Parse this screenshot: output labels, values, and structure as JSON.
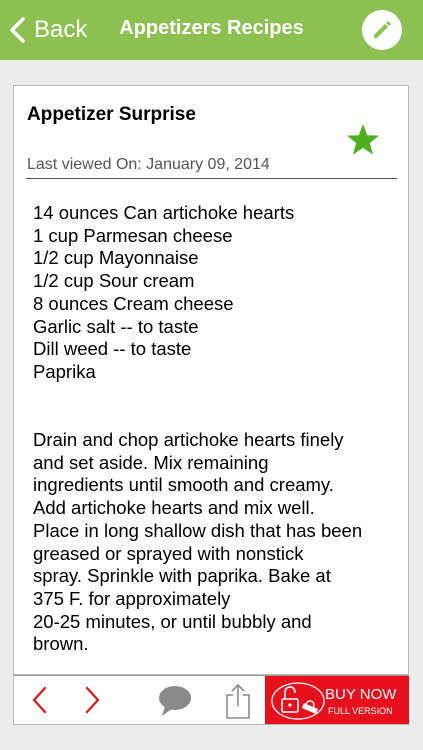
{
  "nav": {
    "back_label": "Back",
    "title": "Appetizers Recipes"
  },
  "recipe": {
    "title": "Appetizer Surprise",
    "last_viewed": "Last viewed On: January 09, 2014",
    "favorite": true,
    "ingredients": [
      "14 ounces Can artichoke hearts",
      "1 cup Parmesan cheese",
      "1/2 cup Mayonnaise",
      "1/2 cup Sour cream",
      "8 ounces Cream cheese",
      "Garlic salt -- to taste",
      "Dill weed -- to taste",
      "Paprika"
    ],
    "directions": [
      "Drain and chop artichoke hearts finely",
      "and set aside. Mix remaining",
      "ingredients until smooth and creamy.",
      "Add artichoke hearts and mix well.",
      "Place in long shallow dish that has been",
      "greased or sprayed with nonstick",
      "spray. Sprinkle with paprika. Bake at",
      "375 F. for approximately",
      "20-25 minutes, or until bubbly and",
      "brown."
    ]
  },
  "toolbar": {
    "buy_label": "BUY NOW",
    "buy_sublabel": "FULL VERSION"
  },
  "colors": {
    "nav_green": "#8cc152",
    "star_green": "#4caf1e",
    "arrow_red": "#e8101c",
    "buy_red": "#e8101c",
    "icon_gray": "#8a8a8a"
  },
  "icons": {
    "back": "chevron-left-icon",
    "edit": "pencil-icon",
    "favorite": "star-icon",
    "prev": "chevron-left-icon",
    "next": "chevron-right-icon",
    "comment": "speech-bubble-icon",
    "share": "share-icon",
    "buy": "unlock-icon"
  }
}
